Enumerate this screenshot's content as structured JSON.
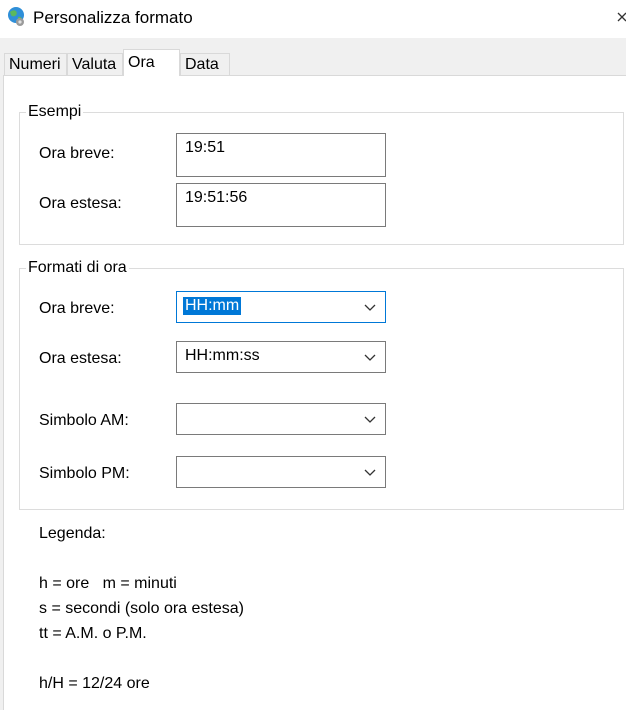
{
  "window": {
    "title": "Personalizza formato",
    "icon": "globe-settings-icon",
    "close_icon": "close-icon"
  },
  "tabs": [
    {
      "label": "Numeri",
      "active": false
    },
    {
      "label": "Valuta",
      "active": false
    },
    {
      "label": "Ora",
      "active": true
    },
    {
      "label": "Data",
      "active": false
    }
  ],
  "examples": {
    "title": "Esempi",
    "short_label": "Ora breve:",
    "short_value": "19:51",
    "long_label": "Ora estesa:",
    "long_value": "19:51:56"
  },
  "formats": {
    "title": "Formati di ora",
    "short_label": "Ora breve:",
    "short_value": "HH:mm",
    "long_label": "Ora estesa:",
    "long_value": "HH:mm:ss",
    "am_label": "Simbolo AM:",
    "am_value": "",
    "pm_label": "Simbolo PM:",
    "pm_value": ""
  },
  "legend": {
    "title": "Legenda:",
    "line1": "h = ore   m = minuti",
    "line2": "s = secondi (solo ora estesa)",
    "line3": "tt = A.M. o P.M.",
    "line4": "h/H = 12/24 ore"
  },
  "colors": {
    "accent": "#0078d7",
    "panel_bg": "#ffffff",
    "dialog_bg": "#f0f0f0"
  }
}
